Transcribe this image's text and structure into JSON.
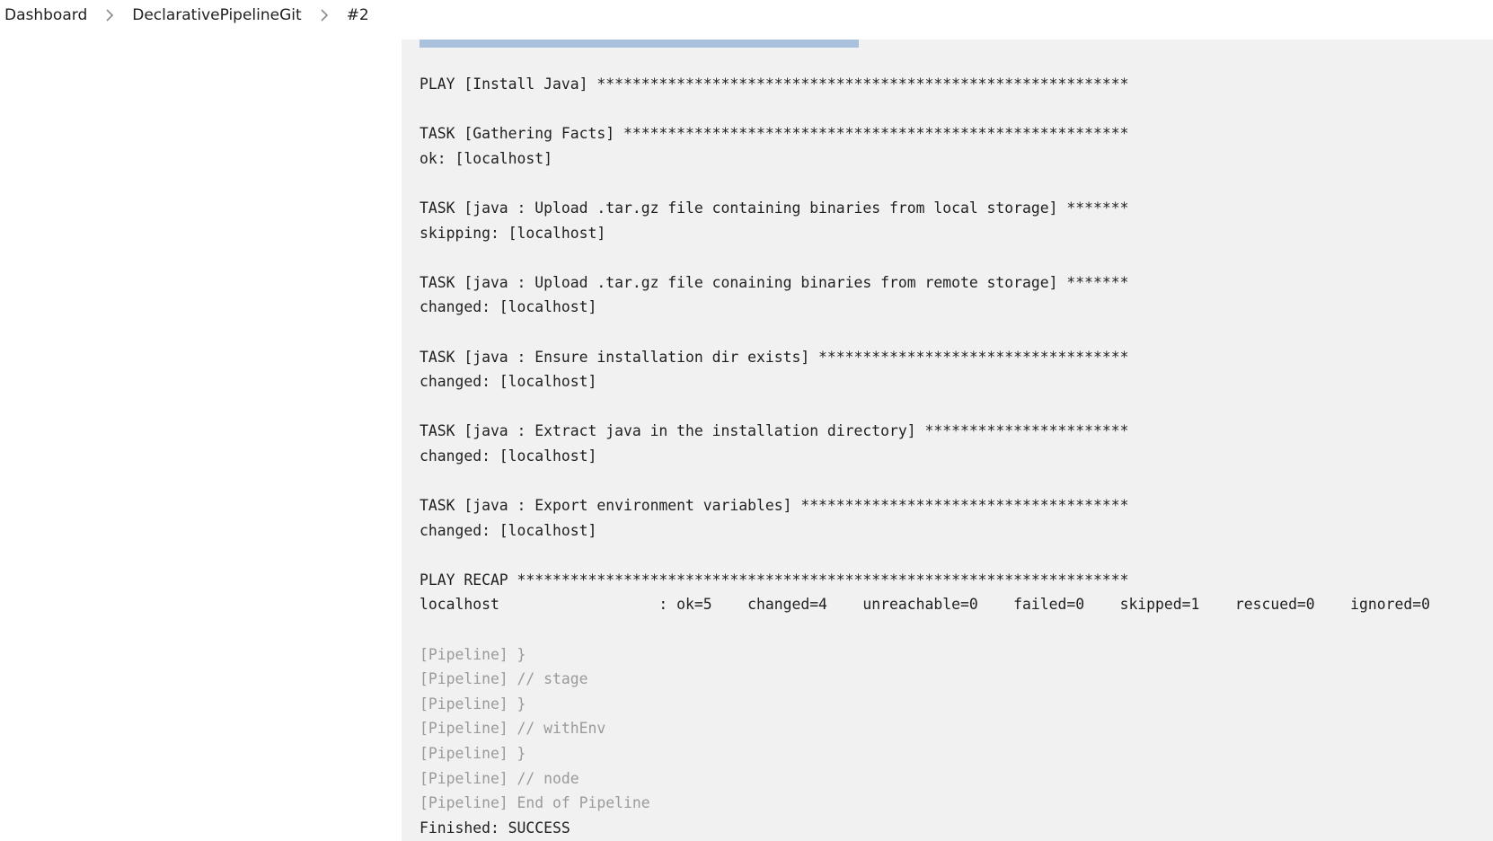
{
  "breadcrumb": {
    "items": [
      "Dashboard",
      "DeclarativePipelineGit",
      "#2"
    ]
  },
  "console": {
    "lines": [
      {
        "text": "PLAY [Install Java] ************************************************************",
        "muted": false
      },
      {
        "text": "",
        "muted": false
      },
      {
        "text": "TASK [Gathering Facts] *********************************************************",
        "muted": false
      },
      {
        "text": "ok: [localhost]",
        "muted": false
      },
      {
        "text": "",
        "muted": false
      },
      {
        "text": "TASK [java : Upload .tar.gz file containing binaries from local storage] *******",
        "muted": false
      },
      {
        "text": "skipping: [localhost]",
        "muted": false
      },
      {
        "text": "",
        "muted": false
      },
      {
        "text": "TASK [java : Upload .tar.gz file conaining binaries from remote storage] *******",
        "muted": false
      },
      {
        "text": "changed: [localhost]",
        "muted": false
      },
      {
        "text": "",
        "muted": false
      },
      {
        "text": "TASK [java : Ensure installation dir exists] ***********************************",
        "muted": false
      },
      {
        "text": "changed: [localhost]",
        "muted": false
      },
      {
        "text": "",
        "muted": false
      },
      {
        "text": "TASK [java : Extract java in the installation directory] ***********************",
        "muted": false
      },
      {
        "text": "changed: [localhost]",
        "muted": false
      },
      {
        "text": "",
        "muted": false
      },
      {
        "text": "TASK [java : Export environment variables] *************************************",
        "muted": false
      },
      {
        "text": "changed: [localhost]",
        "muted": false
      },
      {
        "text": "",
        "muted": false
      },
      {
        "text": "PLAY RECAP *********************************************************************",
        "muted": false
      },
      {
        "text": "localhost                  : ok=5    changed=4    unreachable=0    failed=0    skipped=1    rescued=0    ignored=0",
        "muted": false
      },
      {
        "text": "",
        "muted": false
      },
      {
        "text": "[Pipeline] }",
        "muted": true
      },
      {
        "text": "[Pipeline] // stage",
        "muted": true
      },
      {
        "text": "[Pipeline] }",
        "muted": true
      },
      {
        "text": "[Pipeline] // withEnv",
        "muted": true
      },
      {
        "text": "[Pipeline] }",
        "muted": true
      },
      {
        "text": "[Pipeline] // node",
        "muted": true
      },
      {
        "text": "[Pipeline] End of Pipeline",
        "muted": true
      },
      {
        "text": "Finished: SUCCESS",
        "muted": false
      }
    ]
  }
}
